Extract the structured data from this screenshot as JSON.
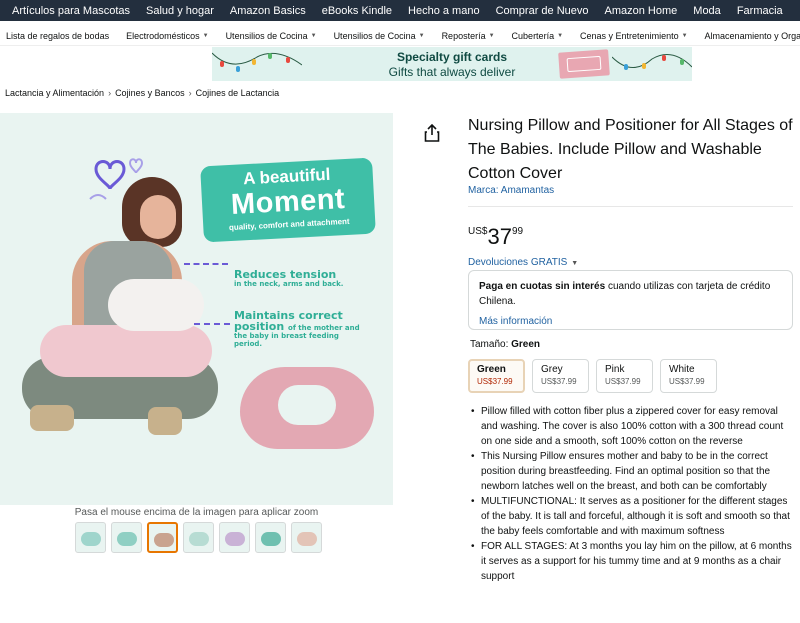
{
  "top_nav": [
    "Artículos para Mascotas",
    "Salud y hogar",
    "Amazon Basics",
    "eBooks Kindle",
    "Hecho a mano",
    "Comprar de Nuevo",
    "Amazon Home",
    "Moda",
    "Farmacia"
  ],
  "sub_nav": [
    "Lista de regalos de bodas",
    "Electrodomésticos",
    "Utensilios de Cocina",
    "Utensilios de Cocina",
    "Repostería",
    "Cubertería",
    "Cenas y Entretenimiento",
    "Almacenamiento y Organización"
  ],
  "banner": {
    "line1": "Specialty gift cards",
    "line2": "Gifts that always deliver"
  },
  "breadcrumb": [
    "Lactancia y Alimentación",
    "Cojines y Bancos",
    "Cojines de Lactancia"
  ],
  "image": {
    "heading_line1": "A beautiful",
    "heading_line2": "Moment",
    "heading_sub": "quality, comfort and attachment",
    "feature1_title": "Reduces tension",
    "feature1_sub": "in the neck, arms and back.",
    "feature2_title_a": "Maintains correct",
    "feature2_title_b": "position",
    "feature2_sub_a": "of the mother and",
    "feature2_sub_b": "the baby in breast feeding",
    "feature2_sub_c": "period."
  },
  "zoom_hint": "Pasa el mouse encima de la imagen para aplicar zoom",
  "thumbnails_selected_index": 2,
  "product": {
    "title": "Nursing Pillow and Positioner for All Stages of The Babies. Include Pillow and Washable  Cotton Cover",
    "brand": "Marca: Amamantas",
    "price_currency": "US$",
    "price_whole": "37",
    "price_fraction": "99",
    "returns": "Devoluciones GRATIS",
    "cuotas_bold": "Paga en cuotas sin interés",
    "cuotas_rest": " cuando utilizas con tarjeta de crédito Chilena.",
    "cuotas_link": "Más información",
    "size_label": "Tamaño: ",
    "size_value": "Green",
    "sizes": [
      {
        "name": "Green",
        "price": "US$37.99"
      },
      {
        "name": "Grey",
        "price": "US$37.99"
      },
      {
        "name": "Pink",
        "price": "US$37.99"
      },
      {
        "name": "White",
        "price": "US$37.99"
      }
    ],
    "bullets": [
      "Pillow filled with cotton fiber plus a zippered cover for easy removal and washing. The cover is also 100% cotton with a 300 thread count on one side and a smooth, soft 100% cotton on the reverse",
      "This Nursing Pillow ensures mother and baby to be in the correct position during breastfeeding. Find an optimal position so that the newborn latches well on the breast, and both can be comfortably",
      "MULTIFUNCTIONAL: It serves as a positioner for the different stages of the baby. It is tall and forceful, although it is soft and smooth so that the baby feels comfortable and with maximum softness",
      "FOR ALL STAGES: At 3 months you lay him on the pillow, at 6 months it serves as a support for his tummy time and at 9 months as a chair support"
    ]
  },
  "colors": {
    "nav_bg": "#232f3e",
    "link": "#2162a1",
    "price_red": "#b12704",
    "accent_teal": "#3fbfa7",
    "selected_border": "#e77600"
  },
  "icons": {
    "share": "share-icon",
    "caret": "chevron-down-icon"
  }
}
